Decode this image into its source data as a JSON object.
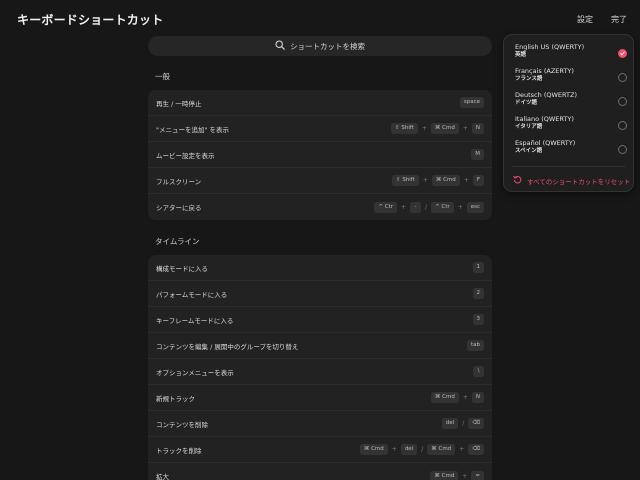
{
  "header": {
    "title": "キーボードショートカット",
    "settings_label": "設定",
    "done_label": "完了"
  },
  "search": {
    "placeholder": "ショートカットを検索"
  },
  "sections": [
    {
      "title": "一般",
      "rows": [
        {
          "label": "再生 / 一時停止",
          "keys": [
            [
              "space"
            ]
          ]
        },
        {
          "label": "\"メニューを追加\" を表示",
          "keys": [
            [
              "⇧ Shift",
              "⌘ Cmd",
              "N"
            ]
          ]
        },
        {
          "label": "ムービー設定を表示",
          "keys": [
            [
              "M"
            ]
          ]
        },
        {
          "label": "フルスクリーン",
          "keys": [
            [
              "⇧ Shift",
              "⌘ Cmd",
              "F"
            ]
          ]
        },
        {
          "label": "シアターに戻る",
          "keys": [
            [
              "^ Ctr",
              "-"
            ],
            [
              "^ Ctr",
              "esc"
            ]
          ]
        }
      ]
    },
    {
      "title": "タイムライン",
      "rows": [
        {
          "label": "構成モードに入る",
          "keys": [
            [
              "1"
            ]
          ]
        },
        {
          "label": "パフォームモードに入る",
          "keys": [
            [
              "2"
            ]
          ]
        },
        {
          "label": "キーフレームモードに入る",
          "keys": [
            [
              "3"
            ]
          ]
        },
        {
          "label": "コンテンツを編集 / 展開中のグループを切り替え",
          "keys": [
            [
              "tab"
            ]
          ]
        },
        {
          "label": "オプションメニューを表示",
          "keys": [
            [
              "\\"
            ]
          ]
        },
        {
          "label": "新規トラック",
          "keys": [
            [
              "⌘ Cmd",
              "N"
            ]
          ]
        },
        {
          "label": "コンテンツを削除",
          "keys": [
            [
              "del"
            ],
            [
              "⌫"
            ]
          ]
        },
        {
          "label": "トラックを削除",
          "keys": [
            [
              "⌘ Cmd",
              "del"
            ],
            [
              "⌘ Cmd",
              "⌫"
            ]
          ]
        },
        {
          "label": "拡大",
          "keys": [
            [
              "⌘ Cmd",
              "="
            ]
          ]
        }
      ]
    }
  ],
  "languages": {
    "options": [
      {
        "name": "English US (QWERTY)",
        "sub": "英語",
        "selected": true
      },
      {
        "name": "Français (AZERTY)",
        "sub": "フランス語",
        "selected": false
      },
      {
        "name": "Deutsch (QWERTZ)",
        "sub": "ドイツ語",
        "selected": false
      },
      {
        "name": "Italiano (QWERTY)",
        "sub": "イタリア語",
        "selected": false
      },
      {
        "name": "Español (QWERTY)",
        "sub": "スペイン語",
        "selected": false
      }
    ],
    "reset_label": "すべてのショートカットをリセット"
  },
  "colors": {
    "accent": "#f0506e",
    "background": "#171717",
    "card": "#222222"
  },
  "icons": {
    "search": "search-icon",
    "selected": "check-icon",
    "reset": "reset-icon"
  }
}
